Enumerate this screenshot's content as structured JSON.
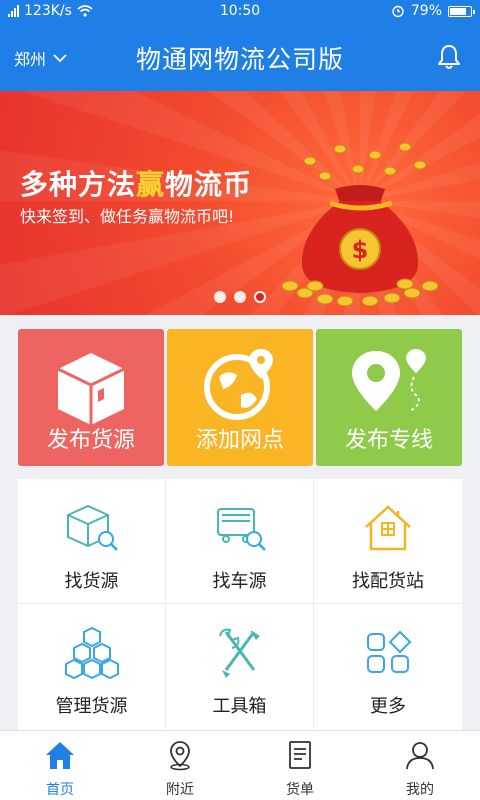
{
  "status_bar": {
    "network": "123K/s",
    "time": "10:50",
    "battery": "79%",
    "battery_level": 0.79
  },
  "header": {
    "city": "郑州",
    "title": "物通网物流公司版"
  },
  "banner": {
    "headline_pre": "多种方法",
    "headline_highlight": "赢",
    "headline_post": "物流币",
    "subtitle": "快来签到、做任务赢物流币吧!",
    "slides": 3,
    "active_slide": 3
  },
  "tiles": [
    {
      "label": "发布货源",
      "icon": "box-icon",
      "color": "#ee6461"
    },
    {
      "label": "添加网点",
      "icon": "globe-pin-icon",
      "color": "#f9b523"
    },
    {
      "label": "发布专线",
      "icon": "route-pin-icon",
      "color": "#8fca4a"
    }
  ],
  "grid": [
    {
      "label": "找货源",
      "icon": "cube-search-icon"
    },
    {
      "label": "找车源",
      "icon": "truck-search-icon"
    },
    {
      "label": "找配货站",
      "icon": "house-icon"
    },
    {
      "label": "管理货源",
      "icon": "stacked-boxes-icon"
    },
    {
      "label": "工具箱",
      "icon": "tools-icon"
    },
    {
      "label": "更多",
      "icon": "more-grid-icon"
    }
  ],
  "tabbar": [
    {
      "label": "首页",
      "icon": "home-icon",
      "active": true
    },
    {
      "label": "附近",
      "icon": "location-pin-icon",
      "active": false
    },
    {
      "label": "货单",
      "icon": "document-icon",
      "active": false
    },
    {
      "label": "我的",
      "icon": "user-icon",
      "active": false
    }
  ],
  "colors": {
    "primary": "#1f7fe6",
    "banner": "#f24a2e",
    "highlight": "#ffd233",
    "icon_teal": "#46b7b2",
    "icon_blue": "#3aa6e8",
    "icon_gold": "#f2b420"
  }
}
